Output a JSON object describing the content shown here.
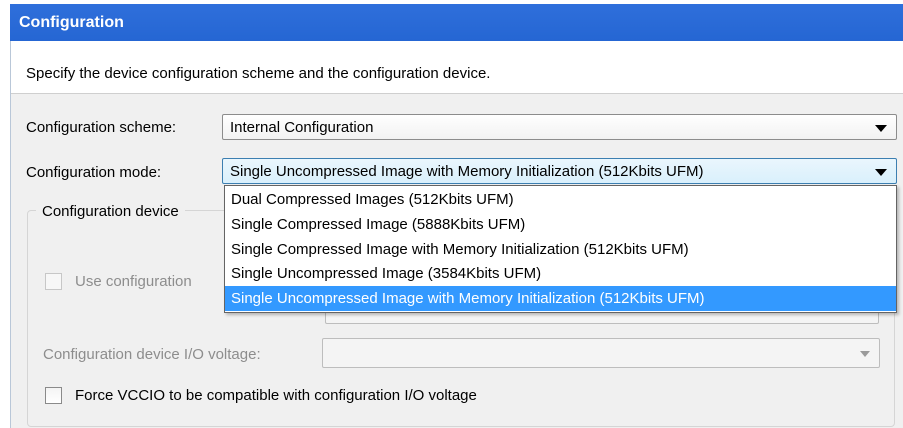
{
  "title": "Configuration",
  "description": "Specify the device configuration scheme and the configuration device.",
  "scheme": {
    "label": "Configuration scheme:",
    "value": "Internal Configuration"
  },
  "mode": {
    "label": "Configuration mode:",
    "value": "Single Uncompressed Image with Memory Initialization (512Kbits UFM)",
    "options": [
      "Dual Compressed Images (512Kbits UFM)",
      "Single Compressed Image (5888Kbits UFM)",
      "Single Compressed Image with Memory Initialization (512Kbits UFM)",
      "Single Uncompressed Image (3584Kbits UFM)",
      "Single Uncompressed Image with Memory Initialization (512Kbits UFM)"
    ],
    "selected_index": 4
  },
  "device_group": {
    "label": "Configuration device",
    "use_config_label": "Use configuration",
    "use_config_checked": false,
    "io_voltage_label": "Configuration device I/O voltage:",
    "io_voltage_value": "",
    "force_vccio_label": "Force VCCIO to be compatible with configuration I/O voltage",
    "force_vccio_checked": false
  },
  "colors": {
    "title_bar": "#2566d3",
    "selection": "#3399ff"
  }
}
